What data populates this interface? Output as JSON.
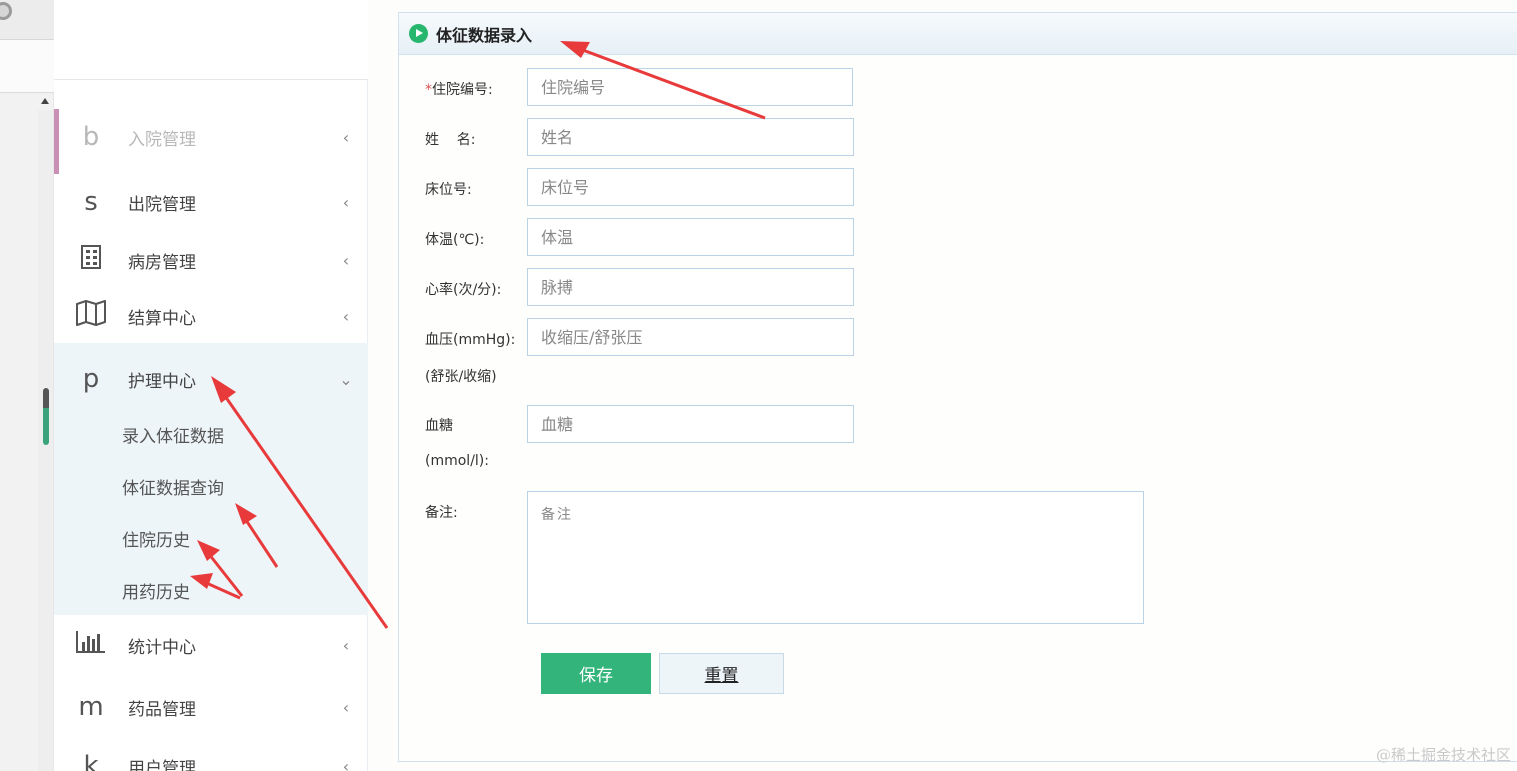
{
  "sidebar": {
    "items": [
      {
        "icon": "b",
        "label": "入院管理",
        "chevron": "‹"
      },
      {
        "icon": "s",
        "label": "出院管理",
        "chevron": "‹"
      },
      {
        "icon": "building-icon",
        "label": "病房管理",
        "chevron": "‹"
      },
      {
        "icon": "map-icon",
        "label": "结算中心",
        "chevron": "‹"
      },
      {
        "icon": "p",
        "label": "护理中心",
        "chevron": "⌄"
      },
      {
        "icon": "bar-chart-icon",
        "label": "统计中心",
        "chevron": "‹"
      },
      {
        "icon": "m",
        "label": "药品管理",
        "chevron": "‹"
      },
      {
        "icon": "k",
        "label": "用户管理",
        "chevron": "‹"
      }
    ],
    "subitems": [
      {
        "label": "录入体征数据"
      },
      {
        "label": "体征数据查询"
      },
      {
        "label": "住院历史"
      },
      {
        "label": "用药历史"
      }
    ]
  },
  "panel": {
    "title": "体征数据录入"
  },
  "form": {
    "required_mark": "*",
    "admission_no": {
      "label": "住院编号:",
      "placeholder": "住院编号"
    },
    "name": {
      "label": "姓    名:",
      "placeholder": "姓名"
    },
    "bed_no": {
      "label": "床位号:",
      "placeholder": "床位号"
    },
    "temperature": {
      "label": "体温(℃):",
      "placeholder": "体温"
    },
    "heart_rate": {
      "label": "心率(次/分):",
      "placeholder": "脉搏"
    },
    "blood_pressure": {
      "label": "血压(mmHg):",
      "label2": "(舒张/收缩)",
      "placeholder": "收缩压/舒张压"
    },
    "blood_sugar": {
      "label": "血糖",
      "label2": "(mmol/l):",
      "placeholder": "血糖"
    },
    "remarks": {
      "label": "备注:",
      "placeholder": "备注"
    },
    "save_label": "保存",
    "reset_label": "重置"
  },
  "watermark": "@稀土掘金技术社区",
  "colors": {
    "accent_green": "#32b47a",
    "annotation_red": "#e83a3a",
    "required_red": "#d9534f"
  }
}
